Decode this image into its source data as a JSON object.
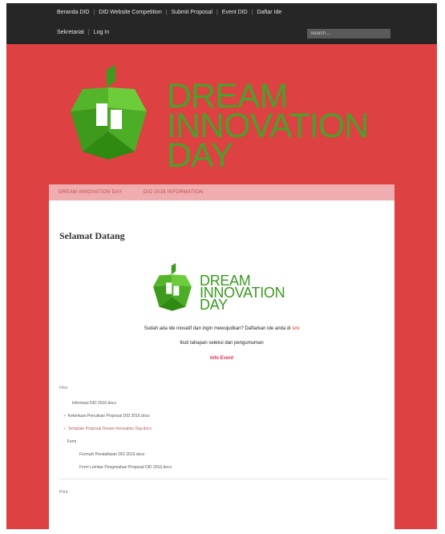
{
  "topbar": {
    "links_row1": [
      "Beranda DID",
      "DID Website Competition",
      "Submit Proposal",
      "Event DID",
      "Daftar Ide"
    ],
    "links_row2": [
      "Sekretariat",
      "Log In"
    ],
    "search_placeholder": "Search ..."
  },
  "header": {
    "logo_lines": [
      "DREAM",
      "INNOVATION",
      "DAY"
    ]
  },
  "tabs": [
    "DREAM INNOVATION DAY",
    "DID 2016 INFORMATION"
  ],
  "page": {
    "title": "Selamat Datang",
    "logo_lines": [
      "DREAM",
      "INNOVATION",
      "DAY"
    ],
    "intro_text": "Sudah ada ide inovatif dan ingin mewujudkan? Daftarkan ide anda di",
    "intro_link": "sini",
    "line2": "Ikuti tahapan seleksi dan pengumuman",
    "line3": "Info Event"
  },
  "files_section_label": "Files",
  "files": [
    {
      "name": "Informasi DID 2016.docx",
      "size": "",
      "link": false,
      "marker": ""
    },
    {
      "name": "Ketentuan Penulisan Proposal DID 2016.docx",
      "size": "",
      "link": false,
      "marker": "+"
    },
    {
      "name": "Template Proposal Dream Innovation Day.docx",
      "size": "",
      "link": true,
      "marker": "+"
    },
    {
      "name": "Form",
      "size": "",
      "link": false,
      "marker": "-"
    },
    {
      "name": "Formulir Pendaftaran DID 2016.docx",
      "size": "",
      "link": false,
      "marker": "",
      "indent": true
    },
    {
      "name": "Form Lembar Pengesahan Proposal DID 2016.docx",
      "size": "",
      "link": false,
      "marker": "",
      "indent": true
    }
  ],
  "footer_label": "Print"
}
